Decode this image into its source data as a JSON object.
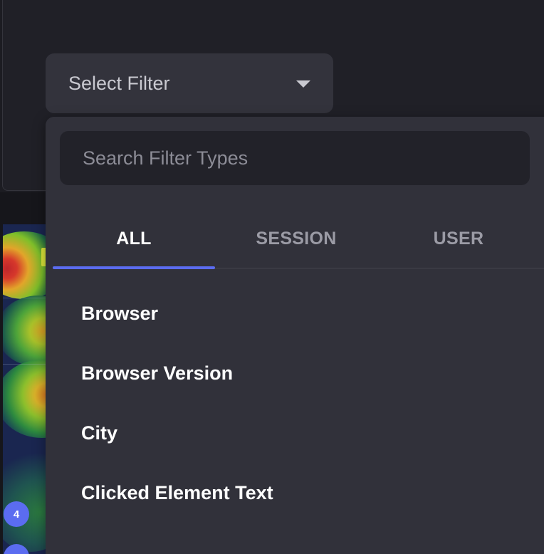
{
  "select": {
    "label": "Select Filter",
    "caret_icon": "chevron-down-icon"
  },
  "dropdown": {
    "search_placeholder": "Search Filter Types",
    "tabs": [
      {
        "label": "ALL",
        "active": true
      },
      {
        "label": "SESSION",
        "active": false
      },
      {
        "label": "USER",
        "active": false
      }
    ],
    "options": [
      {
        "label": "Browser"
      },
      {
        "label": "Browser Version"
      },
      {
        "label": "City"
      },
      {
        "label": "Clicked Element Text"
      }
    ]
  },
  "heatmap": {
    "badges": [
      "4",
      ""
    ]
  },
  "colors": {
    "accent": "#5b6cf0",
    "panel": "#31313a",
    "input": "#222229",
    "background": "#1c1c22"
  }
}
